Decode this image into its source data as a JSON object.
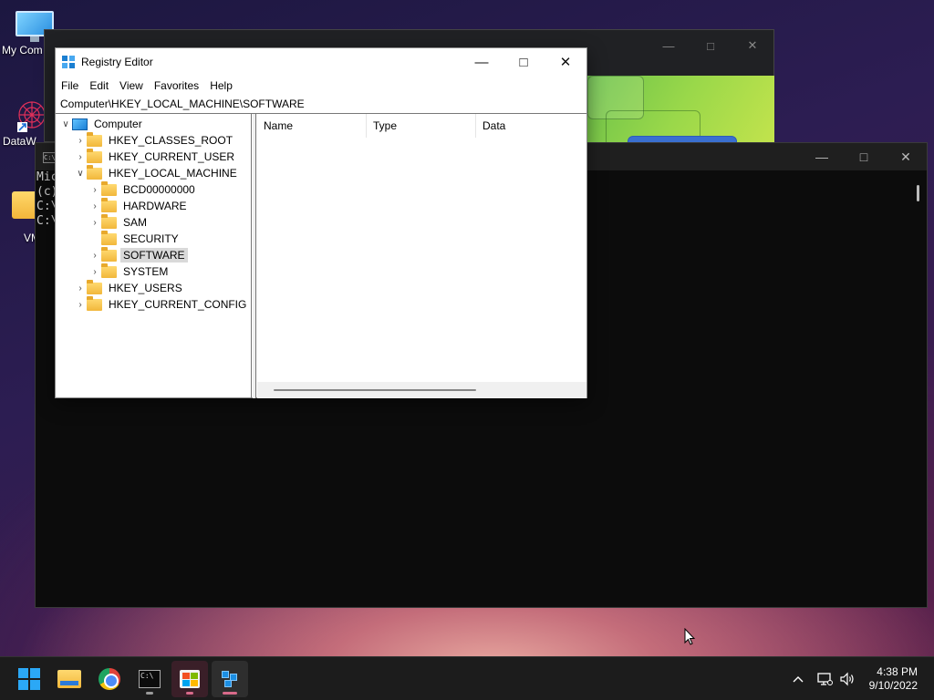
{
  "desktop": {
    "icons": [
      {
        "label": "My Com"
      },
      {
        "label": "DataW"
      },
      {
        "label": "VM"
      }
    ]
  },
  "terminal": {
    "lines": [
      "Mic",
      "(c)",
      "",
      "C:\\",
      "C:\\"
    ],
    "icon_text": "C:\\"
  },
  "browser": {},
  "regedit": {
    "title": "Registry Editor",
    "menu": [
      "File",
      "Edit",
      "View",
      "Favorites",
      "Help"
    ],
    "address": "Computer\\HKEY_LOCAL_MACHINE\\SOFTWARE",
    "tree": [
      {
        "label": "Computer",
        "depth": 0,
        "chevron": "down",
        "icon": "computer"
      },
      {
        "label": "HKEY_CLASSES_ROOT",
        "depth": 1,
        "chevron": "right",
        "icon": "folder"
      },
      {
        "label": "HKEY_CURRENT_USER",
        "depth": 1,
        "chevron": "right",
        "icon": "folder"
      },
      {
        "label": "HKEY_LOCAL_MACHINE",
        "depth": 1,
        "chevron": "down",
        "icon": "folder"
      },
      {
        "label": "BCD00000000",
        "depth": 2,
        "chevron": "right",
        "icon": "folder"
      },
      {
        "label": "HARDWARE",
        "depth": 2,
        "chevron": "right",
        "icon": "folder"
      },
      {
        "label": "SAM",
        "depth": 2,
        "chevron": "right",
        "icon": "folder"
      },
      {
        "label": "SECURITY",
        "depth": 2,
        "chevron": "none",
        "icon": "folder"
      },
      {
        "label": "SOFTWARE",
        "depth": 2,
        "chevron": "right",
        "icon": "folder",
        "selected": true
      },
      {
        "label": "SYSTEM",
        "depth": 2,
        "chevron": "right",
        "icon": "folder"
      },
      {
        "label": "HKEY_USERS",
        "depth": 1,
        "chevron": "right",
        "icon": "folder"
      },
      {
        "label": "HKEY_CURRENT_CONFIG",
        "depth": 1,
        "chevron": "right",
        "icon": "folder"
      }
    ],
    "columns": [
      "Name",
      "Type",
      "Data"
    ]
  },
  "taskbar": {
    "apps": [
      {
        "name": "start-button",
        "icon": "windows-logo-icon"
      },
      {
        "name": "file-explorer-button",
        "icon": "folder-icon"
      },
      {
        "name": "chrome-button",
        "icon": "chrome-icon"
      },
      {
        "name": "command-prompt-button",
        "icon": "terminal-icon",
        "running": true
      },
      {
        "name": "microsoft-store-button",
        "icon": "store-icon",
        "running": true
      },
      {
        "name": "registry-editor-button",
        "icon": "regedit-icon",
        "running": true,
        "active": true
      }
    ],
    "clock": {
      "time": "4:38 PM",
      "date": "9/10/2022"
    }
  },
  "colors": {
    "accent": "#0078d4",
    "taskbar": "#1c1c1c",
    "terminal_bg": "#0c0c0c"
  }
}
